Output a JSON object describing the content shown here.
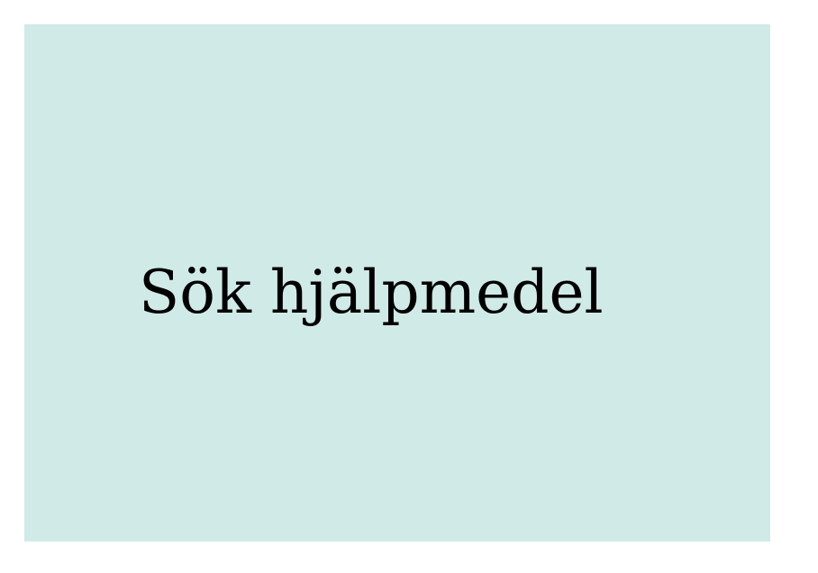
{
  "tile": {
    "label": "Sök hjälpmedel",
    "background_color": "#d0eae7",
    "text_color": "#000000"
  },
  "page": {
    "background_color": "#ffffff"
  }
}
